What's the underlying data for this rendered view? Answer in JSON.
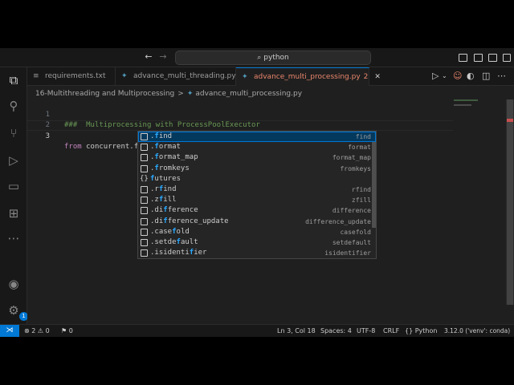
{
  "titlebar": {
    "search_text": "python"
  },
  "tabs": [
    {
      "label": "requirements.txt",
      "icon": "text-file-icon"
    },
    {
      "label": "advance_multi_threading.py",
      "icon": "python-file-icon"
    },
    {
      "label": "advance_multi_processing.py",
      "icon": "python-file-icon",
      "modified": "2",
      "close": "✕"
    }
  ],
  "breadcrumb": {
    "folder": "16-Multithreading and Multiprocessing",
    "separator": ">",
    "file": "advance_multi_processing.py"
  },
  "editor": {
    "lines": [
      {
        "number": "1",
        "comment": "###  Multiprocessing with ProcessPoolExecutor"
      },
      {
        "number": "2"
      },
      {
        "number": "3",
        "keyword": "from",
        "text": "concurrent.f"
      }
    ]
  },
  "suggest": {
    "items": [
      {
        "label": "find",
        "detail": "find",
        "kind": "box"
      },
      {
        "label": "format",
        "detail": "format",
        "kind": "box"
      },
      {
        "label": "format_map",
        "detail": "format_map",
        "kind": "box"
      },
      {
        "label": "fromkeys",
        "detail": "fromkeys",
        "kind": "box"
      },
      {
        "label": "futures",
        "detail": "",
        "kind": "module",
        "kind_glyph": "{}"
      },
      {
        "label": "rfind",
        "detail": "rfind",
        "kind": "box"
      },
      {
        "label": "zfill",
        "detail": "zfill",
        "kind": "box"
      },
      {
        "label": "difference",
        "detail": "difference",
        "kind": "box"
      },
      {
        "label": "difference_update",
        "detail": "difference_update",
        "kind": "box"
      },
      {
        "label": "casefold",
        "detail": "casefold",
        "kind": "box"
      },
      {
        "label": "setdefault",
        "detail": "setdefault",
        "kind": "box"
      },
      {
        "label": "isidentifier",
        "detail": "isidentifier",
        "kind": "box"
      }
    ],
    "selected_index": 0
  },
  "statusbar": {
    "errors": "2",
    "warnings": "0",
    "ports": "0",
    "position": "Ln 3, Col 18",
    "spaces": "Spaces: 4",
    "encoding": "UTF-8",
    "eol": "CRLF",
    "language": "Python",
    "interpreter": "3.12.0 ('venv': conda)"
  },
  "activitybar": {
    "accounts_badge": "1"
  },
  "colors": {
    "accent": "#0078d4",
    "modified_tab": "#e9866c",
    "comment": "#6a9955",
    "keyword": "#c586c0",
    "match_highlight": "#2aaaff"
  }
}
